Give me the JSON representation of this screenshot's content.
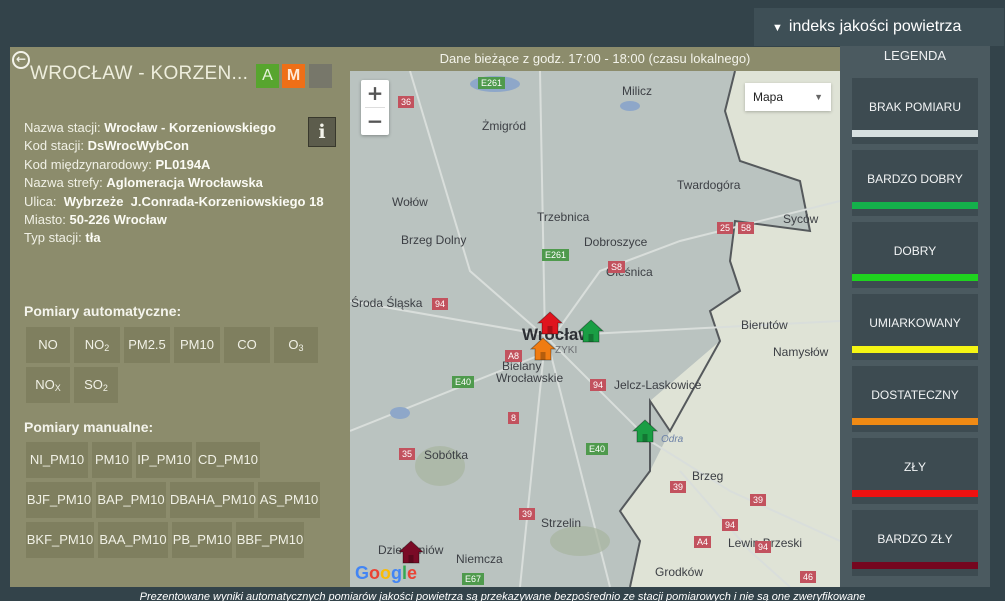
{
  "station": {
    "title": "WROCŁAW - KORZEN...",
    "badges": {
      "automatic": "A",
      "manual": "M",
      "empty": ""
    },
    "info_rows": [
      {
        "label": "Nazwa stacji: ",
        "value": "Wrocław - Korzeniowskiego"
      },
      {
        "label": "Kod stacji: ",
        "value": "DsWrocWybCon"
      },
      {
        "label": "Kod międzynarodowy: ",
        "value": "PL0194A"
      },
      {
        "label": "Nazwa strefy: ",
        "value": "Aglomeracja Wrocławska"
      },
      {
        "label": "Ulica:  ",
        "value": "Wybrzeże  J.Conrada-Korzeniowskiego 18"
      },
      {
        "label": "Miasto: ",
        "value": "50-226 Wrocław"
      },
      {
        "label": "Typ stacji: ",
        "value": "tła"
      }
    ],
    "info_button": "i",
    "automatic_title": "Pomiary automatyczne:",
    "automatic": [
      {
        "base": "NO",
        "sub": ""
      },
      {
        "base": "NO",
        "sub": "2"
      },
      {
        "base": "PM2.5",
        "sub": ""
      },
      {
        "base": "PM10",
        "sub": ""
      },
      {
        "base": "CO",
        "sub": ""
      },
      {
        "base": "O",
        "sub": "3"
      },
      {
        "base": "NO",
        "sub": "X"
      },
      {
        "base": "SO",
        "sub": "2"
      }
    ],
    "manual_title": "Pomiary manualne:",
    "manual": [
      "NI_PM10",
      "PM10",
      "IP_PM10",
      "CD_PM10",
      "BJF_PM10",
      "BAP_PM10",
      "DBAHA_PM10",
      "AS_PM10",
      "BKF_PM10",
      "BAA_PM10",
      "PB_PM10",
      "BBF_PM10"
    ]
  },
  "map": {
    "header": "Dane bieżące z godz. 17:00 - 18:00 (czasu lokalnego)",
    "zoom_in": "+",
    "zoom_out": "−",
    "map_type": "Mapa",
    "google": "Google",
    "towns": [
      {
        "name": "Milicz",
        "cls": ""
      },
      {
        "name": "Żmigród",
        "cls": ""
      },
      {
        "name": "Twardogóra",
        "cls": ""
      },
      {
        "name": "Wołów",
        "cls": ""
      },
      {
        "name": "Trzebnica",
        "cls": ""
      },
      {
        "name": "Syców",
        "cls": ""
      },
      {
        "name": "Brzeg Dolny",
        "cls": ""
      },
      {
        "name": "Dobroszyce",
        "cls": ""
      },
      {
        "name": "Oleśnica",
        "cls": ""
      },
      {
        "name": "Środa Śląska",
        "cls": ""
      },
      {
        "name": "Wrocław",
        "cls": "big"
      },
      {
        "name": "Bierutów",
        "cls": ""
      },
      {
        "name": "Namysłów",
        "cls": ""
      },
      {
        "name": "Bielany",
        "cls": ""
      },
      {
        "name": "Wrocławskie",
        "cls": ""
      },
      {
        "name": "Jelcz-Laskowice",
        "cls": ""
      },
      {
        "name": "Sobótka",
        "cls": ""
      },
      {
        "name": "Brzeg",
        "cls": ""
      },
      {
        "name": "Strzelin",
        "cls": ""
      },
      {
        "name": "Lewin Brzeski",
        "cls": ""
      },
      {
        "name": "Dzierżoniów",
        "cls": ""
      },
      {
        "name": "Niemcza",
        "cls": ""
      },
      {
        "name": "Grodków",
        "cls": ""
      },
      {
        "name": "ZYKI",
        "cls": "small"
      },
      {
        "name": "Odra",
        "cls": "small"
      }
    ],
    "roads": [
      "E261",
      "36",
      "25",
      "58",
      "E261",
      "S8",
      "94",
      "A8",
      "E40",
      "94",
      "8",
      "35",
      "E40",
      "39",
      "39",
      "39",
      "94",
      "A4",
      "94",
      "E67",
      "46"
    ],
    "markers": [
      {
        "name": "station-marker-wroclaw-center",
        "color": "#e0141e"
      },
      {
        "name": "station-marker-wroclaw-east",
        "color": "#1a9e44"
      },
      {
        "name": "station-marker-wroclaw-south",
        "color": "#f07c12"
      },
      {
        "name": "station-marker-jelcz",
        "color": "#1a9e44"
      },
      {
        "name": "station-marker-dzierzoniow",
        "color": "#7a0a26"
      }
    ]
  },
  "legend": {
    "toggle_label": "indeks jakości powietrza",
    "toggle_arrow": "▼",
    "title": "LEGENDA",
    "items": [
      {
        "label": "BRAK POMIARU",
        "color": "#d6dfe0"
      },
      {
        "label": "BARDZO DOBRY",
        "color": "#14b14b"
      },
      {
        "label": "DOBRY",
        "color": "#1fd31f"
      },
      {
        "label": "UMIARKOWANY",
        "color": "#f5f514"
      },
      {
        "label": "DOSTATECZNY",
        "color": "#f08a14"
      },
      {
        "label": "ZŁY",
        "color": "#ee1111"
      },
      {
        "label": "BARDZO ZŁY",
        "color": "#75061f"
      }
    ]
  },
  "footer": {
    "note": "Prezentowane wyniki automatycznych pomiarów jakości powietrza są przekazywane bezpośrednio ze stacji pomiarowych i nie są one zweryfikowane"
  }
}
